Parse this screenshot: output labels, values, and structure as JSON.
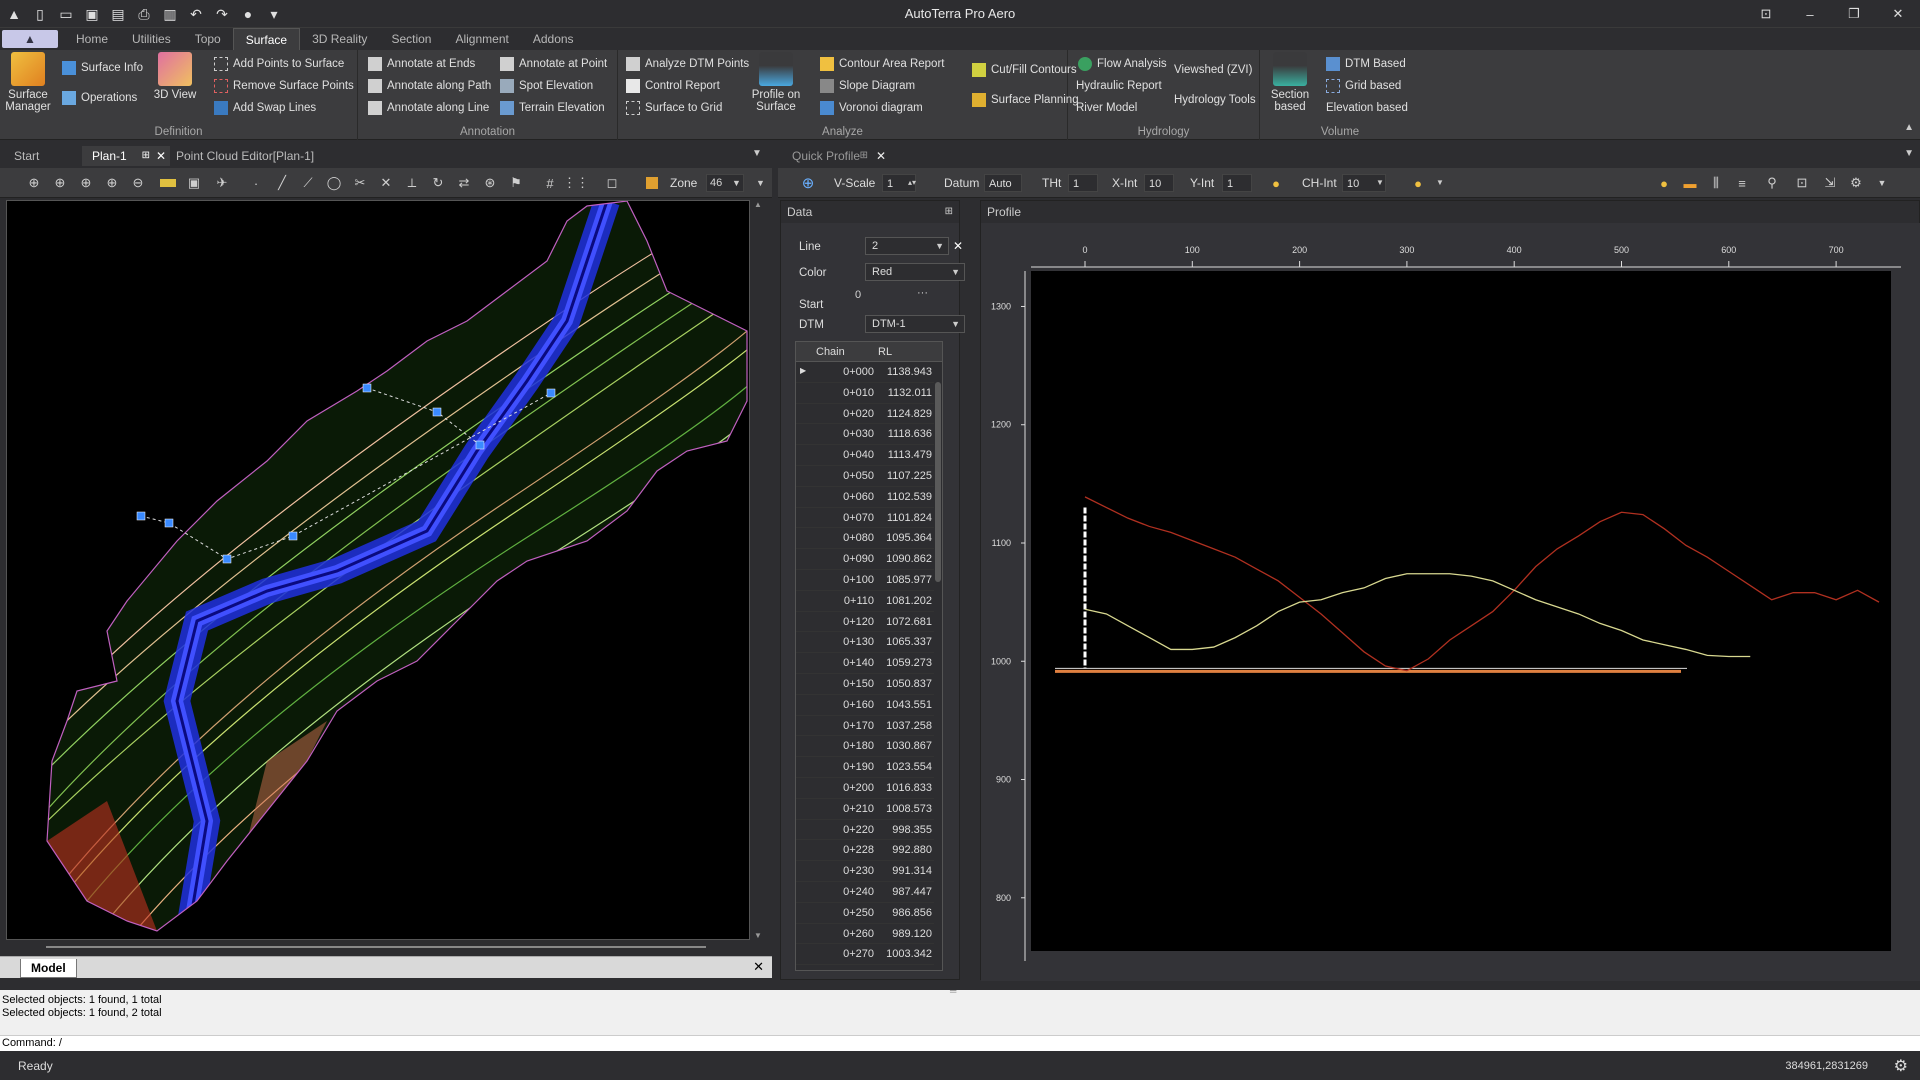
{
  "window": {
    "title": "AutoTerra Pro Aero"
  },
  "menu": {
    "tabs": [
      "Home",
      "Utilities",
      "Topo",
      "Surface",
      "3D Reality",
      "Section",
      "Alignment",
      "Addons"
    ],
    "active": "Surface"
  },
  "ribbon": {
    "definition": {
      "label": "Definition",
      "surface_manager": "Surface Manager",
      "surface_info": "Surface Info",
      "operations": "Operations",
      "view3d": "3D View",
      "add_points": "Add Points to Surface",
      "remove_points": "Remove Surface Points",
      "add_swap": "Add Swap Lines"
    },
    "annotation": {
      "label": "Annotation",
      "annotate_ends": "Annotate at Ends",
      "annotate_path": "Annotate along Path",
      "annotate_line": "Annotate along Line",
      "annotate_point": "Annotate at Point",
      "spot_elevation": "Spot Elevation",
      "terrain_elevation": "Terrain Elevation"
    },
    "analyze": {
      "label": "Analyze",
      "analyze_dtm": "Analyze DTM Points",
      "control_report": "Control Report",
      "surface_grid": "Surface to Grid",
      "profile_surface": "Profile on Surface",
      "contour_area": "Contour Area Report",
      "slope_diagram": "Slope Diagram",
      "voronoi": "Voronoi diagram",
      "cutfill": "Cut/Fill Contours",
      "surface_planning": "Surface Planning"
    },
    "hydrology": {
      "label": "Hydrology",
      "flow": "Flow Analysis",
      "hydraulic": "Hydraulic Report",
      "river": "River Model",
      "viewshed": "Viewshed (ZVI)",
      "hydro_tools": "Hydrology Tools"
    },
    "volume": {
      "label": "Volume",
      "section_based": "Section based",
      "dtm_based": "DTM Based",
      "grid_based": "Grid based",
      "elevation_based": "Elevation based"
    }
  },
  "doc_tabs": {
    "start": "Start",
    "plan": "Plan-1",
    "pce": "Point Cloud Editor[Plan-1]"
  },
  "cad_toolbar": {
    "zone_label": "Zone",
    "zone_value": "46"
  },
  "model_tab": "Model",
  "quick_profile": {
    "tab": "Quick Profile",
    "vscale_label": "V-Scale",
    "vscale": "1",
    "datum_label": "Datum",
    "datum": "Auto",
    "tht_label": "THt",
    "tht": "1",
    "xint_label": "X-Int",
    "xint": "10",
    "yint_label": "Y-Int",
    "yint": "1",
    "chint_label": "CH-Int",
    "chint": "10"
  },
  "data_panel": {
    "title": "Data",
    "line_label": "Line",
    "line_value": "2",
    "color_label": "Color",
    "color_value": "Red",
    "start_label": "Start",
    "start_value": "0",
    "dtm_label": "DTM",
    "dtm_value": "DTM-1",
    "col_chain": "Chain",
    "col_rl": "RL",
    "rows": [
      [
        "0+000",
        "1138.943"
      ],
      [
        "0+010",
        "1132.011"
      ],
      [
        "0+020",
        "1124.829"
      ],
      [
        "0+030",
        "1118.636"
      ],
      [
        "0+040",
        "1113.479"
      ],
      [
        "0+050",
        "1107.225"
      ],
      [
        "0+060",
        "1102.539"
      ],
      [
        "0+070",
        "1101.824"
      ],
      [
        "0+080",
        "1095.364"
      ],
      [
        "0+090",
        "1090.862"
      ],
      [
        "0+100",
        "1085.977"
      ],
      [
        "0+110",
        "1081.202"
      ],
      [
        "0+120",
        "1072.681"
      ],
      [
        "0+130",
        "1065.337"
      ],
      [
        "0+140",
        "1059.273"
      ],
      [
        "0+150",
        "1050.837"
      ],
      [
        "0+160",
        "1043.551"
      ],
      [
        "0+170",
        "1037.258"
      ],
      [
        "0+180",
        "1030.867"
      ],
      [
        "0+190",
        "1023.554"
      ],
      [
        "0+200",
        "1016.833"
      ],
      [
        "0+210",
        "1008.573"
      ],
      [
        "0+220",
        "998.355"
      ],
      [
        "0+228",
        "992.880"
      ],
      [
        "0+230",
        "991.314"
      ],
      [
        "0+240",
        "987.447"
      ],
      [
        "0+250",
        "986.856"
      ],
      [
        "0+260",
        "989.120"
      ],
      [
        "0+270",
        "1003.342"
      ]
    ]
  },
  "profile": {
    "title": "Profile",
    "x_ticks": [
      "0",
      "100",
      "200",
      "300",
      "400",
      "500",
      "600",
      "700"
    ],
    "y_ticks": [
      "1300",
      "1200",
      "1100",
      "1000",
      "900",
      "800"
    ]
  },
  "chart_data": {
    "type": "line",
    "title": "Profile",
    "xlim": [
      0,
      760
    ],
    "ylim": [
      755,
      1330
    ],
    "series": [
      {
        "name": "Red",
        "color": "#b03020",
        "x": [
          0,
          20,
          40,
          60,
          80,
          100,
          120,
          140,
          160,
          180,
          200,
          220,
          240,
          260,
          280,
          300,
          320,
          340,
          360,
          380,
          400,
          420,
          440,
          460,
          480,
          500,
          520,
          540,
          560,
          580,
          600,
          620,
          640,
          660,
          680,
          700,
          720,
          740
        ],
        "y": [
          1139,
          1130,
          1121,
          1114,
          1109,
          1102,
          1095,
          1088,
          1078,
          1068,
          1054,
          1040,
          1024,
          1008,
          996,
          992,
          1002,
          1018,
          1030,
          1042,
          1060,
          1080,
          1095,
          1106,
          1118,
          1126,
          1124,
          1112,
          1098,
          1088,
          1076,
          1064,
          1052,
          1058,
          1058,
          1052,
          1060,
          1050
        ]
      },
      {
        "name": "Yellow",
        "color": "#d8d890",
        "x": [
          0,
          20,
          40,
          60,
          80,
          100,
          120,
          140,
          160,
          180,
          200,
          220,
          240,
          260,
          280,
          300,
          320,
          340,
          360,
          380,
          400,
          420,
          440,
          460,
          480,
          500,
          520,
          540,
          560,
          580,
          600,
          620
        ],
        "y": [
          1044,
          1040,
          1030,
          1020,
          1010,
          1010,
          1012,
          1020,
          1030,
          1042,
          1050,
          1052,
          1058,
          1062,
          1070,
          1074,
          1074,
          1074,
          1072,
          1068,
          1060,
          1052,
          1046,
          1040,
          1032,
          1026,
          1018,
          1014,
          1010,
          1005,
          1004,
          1004
        ]
      }
    ],
    "baseline": 994
  },
  "cmd": {
    "line1": "Selected objects: 1 found, 1 total",
    "line2": "Selected objects: 1 found, 2 total",
    "prompt": "Command: /"
  },
  "status": {
    "ready": "Ready",
    "coords": "384961,2831269"
  }
}
